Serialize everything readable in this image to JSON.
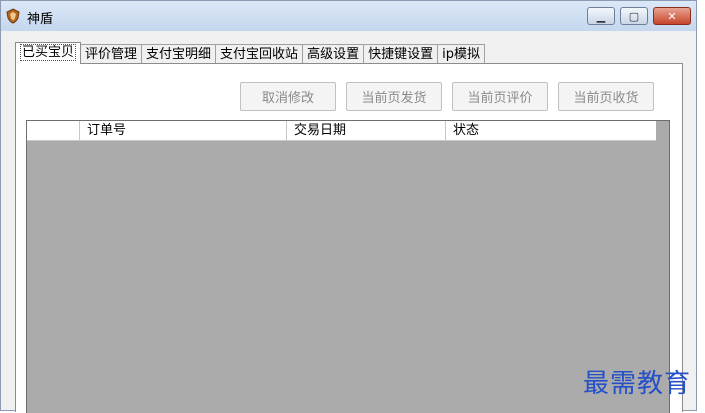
{
  "window": {
    "title": "神盾",
    "icon": "app-shield-icon",
    "controls": [
      "minimize",
      "maximize",
      "close"
    ]
  },
  "tabs": [
    {
      "label": "已买宝贝",
      "active": true
    },
    {
      "label": "评价管理",
      "active": false
    },
    {
      "label": "支付宝明细",
      "active": false
    },
    {
      "label": "支付宝回收站",
      "active": false
    },
    {
      "label": "高级设置",
      "active": false
    },
    {
      "label": "快捷键设置",
      "active": false
    },
    {
      "label": "ip模拟",
      "active": false
    }
  ],
  "toolbar": {
    "cancel_edit": "取消修改",
    "ship_current_page": "当前页发货",
    "review_current_page": "当前页评价",
    "receive_current_page": "当前页收货"
  },
  "grid": {
    "columns": [
      "订单号",
      "交易日期",
      "状态"
    ],
    "rows": []
  },
  "colors": {
    "grid_background": "#ababab",
    "titlebar": "#c5d7ee",
    "close_button": "#c7452b",
    "watermark": "#2450c8"
  },
  "watermark": "最需教育"
}
